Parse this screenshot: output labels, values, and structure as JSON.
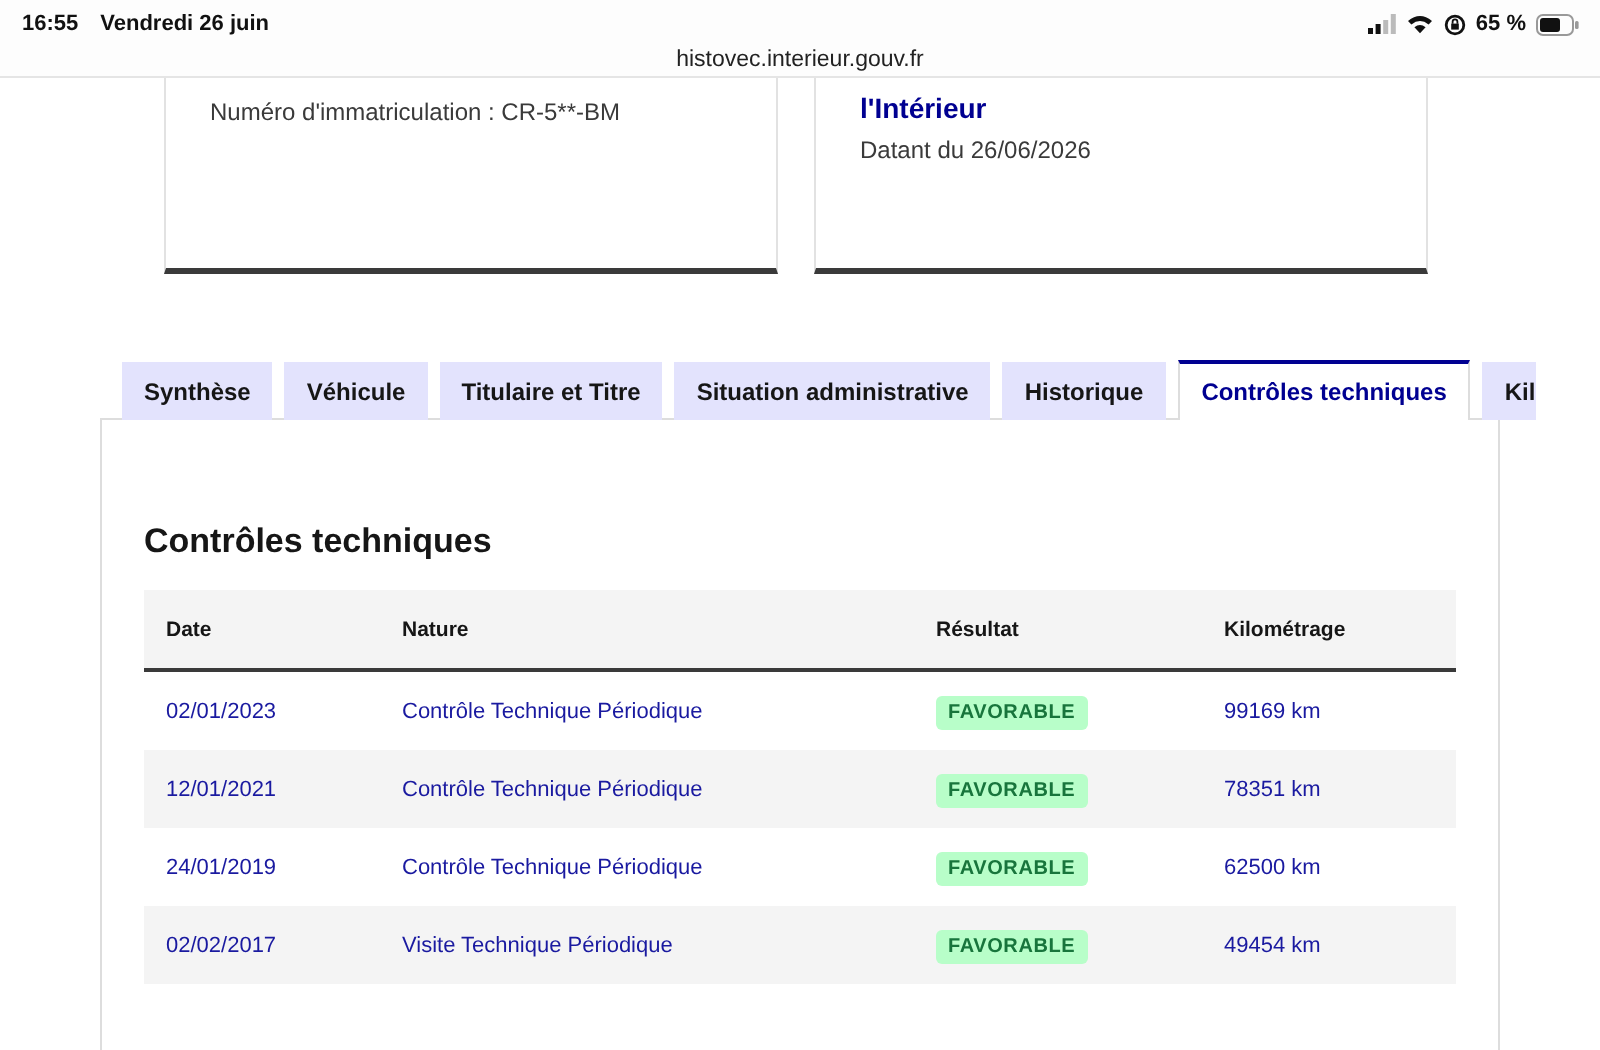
{
  "status_bar": {
    "time": "16:55",
    "date": "Vendredi 26 juin",
    "battery": "65 %"
  },
  "address_bar": {
    "url": "histovec.interieur.gouv.fr"
  },
  "cards": [
    {
      "lines": [
        {
          "kind": "text",
          "text": "Numéro d'immatriculation : CR-5**-BM"
        }
      ]
    },
    {
      "lines": [
        {
          "kind": "title",
          "text": "l'Intérieur"
        },
        {
          "kind": "text",
          "text": "Datant du 26/06/2026"
        }
      ]
    }
  ],
  "tabs": [
    {
      "label": "Synthèse",
      "selected": false
    },
    {
      "label": "Véhicule",
      "selected": false
    },
    {
      "label": "Titulaire et Titre",
      "selected": false
    },
    {
      "label": "Situation administrative",
      "selected": false
    },
    {
      "label": "Historique",
      "selected": false
    },
    {
      "label": "Contrôles techniques",
      "selected": true
    },
    {
      "label": "Kil",
      "selected": false
    }
  ],
  "section": {
    "title": "Contrôles techniques",
    "table": {
      "columns": [
        "Date",
        "Nature",
        "Résultat",
        "Kilométrage"
      ],
      "rows": [
        {
          "date": "02/01/2023",
          "nature": "Contrôle Technique Périodique",
          "result": "FAVORABLE",
          "mileage": "99169 km"
        },
        {
          "date": "12/01/2021",
          "nature": "Contrôle Technique Périodique",
          "result": "FAVORABLE",
          "mileage": "78351 km"
        },
        {
          "date": "24/01/2019",
          "nature": "Contrôle Technique Périodique",
          "result": "FAVORABLE",
          "mileage": "62500 km"
        },
        {
          "date": "02/02/2017",
          "nature": "Visite Technique Périodique",
          "result": "FAVORABLE",
          "mileage": "49454 km"
        }
      ]
    }
  }
}
